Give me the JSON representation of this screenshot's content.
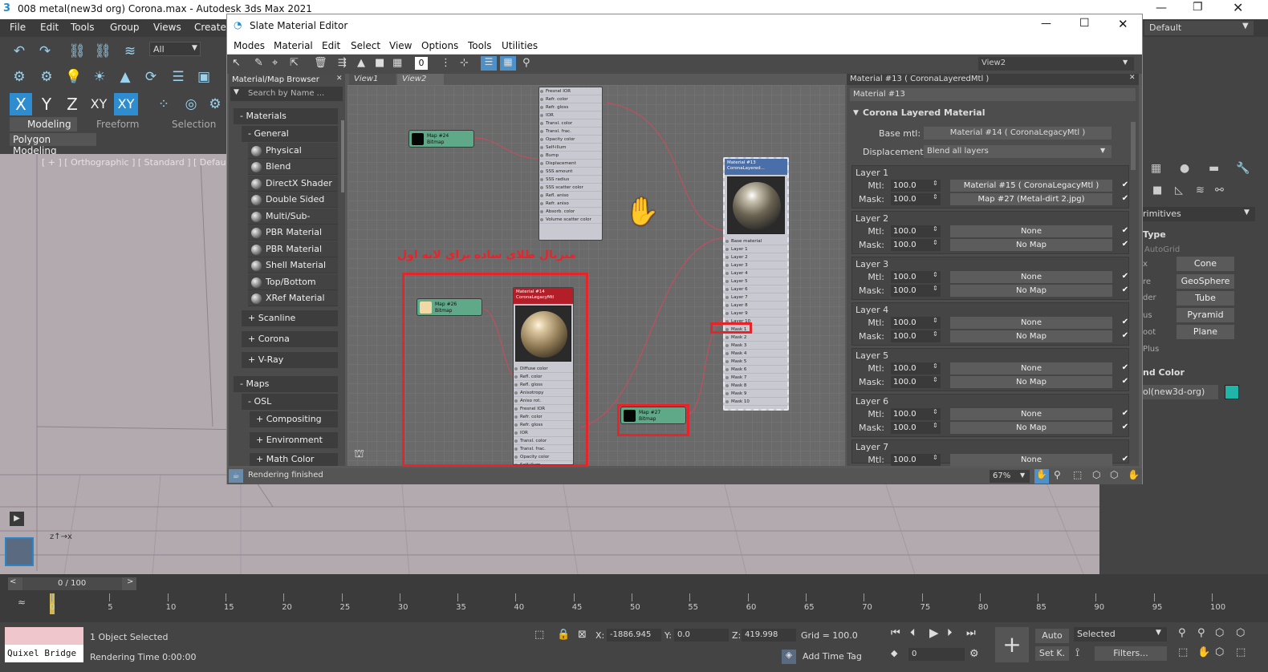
{
  "app": {
    "title": "008 metal(new3d org) Corona.max - Autodesk 3ds Max 2021",
    "workspace": "Default",
    "menu": [
      "File",
      "Edit",
      "Tools",
      "Group",
      "Views",
      "Create"
    ],
    "selection_filter": "All",
    "axes": [
      "X",
      "Y",
      "Z",
      "XY",
      "XY"
    ],
    "ribbon_tabs": [
      "Modeling",
      "Freeform",
      "Selection"
    ],
    "ribbon_sub": "Polygon Modeling",
    "viewport_label": "[ + ] [ Orthographic ] [ Standard ] [ Default Sha"
  },
  "slate": {
    "title": "Slate Material Editor",
    "menu": [
      "Modes",
      "Material",
      "Edit",
      "Select",
      "View",
      "Options",
      "Tools",
      "Utilities"
    ],
    "view_dropdown": "View2",
    "browser_title": "Material/Map Browser",
    "search_placeholder": "Search by Name ...",
    "cat_materials": "- Materials",
    "cat_general": "- General",
    "materials": [
      "Physical Material",
      "Blend",
      "DirectX Shader",
      "Double Sided",
      "Multi/Sub-Object",
      "PBR Material (M...",
      "PBR Material (S...",
      "Shell Material",
      "Top/Bottom",
      "XRef Material"
    ],
    "cat_scanline": "+ Scanline",
    "cat_corona": "+ Corona",
    "cat_vray": "+ V-Ray",
    "cat_maps": "- Maps",
    "cat_osl": "- OSL",
    "osl_items": [
      "+ Compositing",
      "+ Environment",
      "+ Math Color"
    ],
    "view_tabs": [
      "View1",
      "View2"
    ],
    "annotation": "متریال طلای ساده برای لایه اول",
    "status": "Rendering finished",
    "zoom": "67%"
  },
  "nodes": {
    "map24": {
      "name": "Map #24",
      "type": "Bitmap"
    },
    "map26": {
      "name": "Map #26",
      "type": "Bitmap"
    },
    "map27": {
      "name": "Map #27",
      "type": "Bitmap"
    },
    "legacy_title": "Material #14\nCoronaLegacyMtl",
    "legacy_slots": [
      "Diffuse color",
      "Refl. color",
      "Refl. gloss",
      "Anisotropy",
      "Aniso rot.",
      "Fresnel IOR",
      "Refr. color",
      "Refr. gloss",
      "IOR",
      "Transl. color",
      "Transl. frac.",
      "Opacity color",
      "Self-illum"
    ],
    "top_slots": [
      "Fresnel IOR",
      "Refr. color",
      "Refr. gloss",
      "IOR",
      "Transl. color",
      "Transl. frac.",
      "Opacity color",
      "Self-illum",
      "Bump",
      "Displacement",
      "SSS amount",
      "SSS radius",
      "SSS scatter color",
      "Refl. aniso",
      "Refr. aniso",
      "Absorb. color",
      "Volume scatter color"
    ],
    "layered_title": "Material #13\nCoronaLayered...",
    "layered_slots": [
      "Base material",
      "Layer 1",
      "Layer 2",
      "Layer 3",
      "Layer 4",
      "Layer 5",
      "Layer 6",
      "Layer 7",
      "Layer 8",
      "Layer 9",
      "Layer 10",
      "Mask 1",
      "Mask 2",
      "Mask 3",
      "Mask 4",
      "Mask 5",
      "Mask 6",
      "Mask 7",
      "Mask 8",
      "Mask 9",
      "Mask 10"
    ]
  },
  "props": {
    "header": "Material #13  ( CoronaLayeredMtl )",
    "name_field": "Material #13",
    "rollout": "Corona Layered Material",
    "base_label": "Base mtl:",
    "base_value": "Material #14  ( CoronaLegacyMtl )",
    "disp_label": "Displacement:",
    "disp_value": "Blend all layers",
    "mtl_label": "Mtl:",
    "mask_label": "Mask:",
    "layers": [
      {
        "name": "Layer 1",
        "mtl_amt": "100.0",
        "mtl": "Material #15  ( CoronaLegacyMtl )",
        "mask_amt": "100.0",
        "mask": "Map #27 (Metal-dirt 2.jpg)"
      },
      {
        "name": "Layer 2",
        "mtl_amt": "100.0",
        "mtl": "None",
        "mask_amt": "100.0",
        "mask": "No Map"
      },
      {
        "name": "Layer 3",
        "mtl_amt": "100.0",
        "mtl": "None",
        "mask_amt": "100.0",
        "mask": "No Map"
      },
      {
        "name": "Layer 4",
        "mtl_amt": "100.0",
        "mtl": "None",
        "mask_amt": "100.0",
        "mask": "No Map"
      },
      {
        "name": "Layer 5",
        "mtl_amt": "100.0",
        "mtl": "None",
        "mask_amt": "100.0",
        "mask": "No Map"
      },
      {
        "name": "Layer 6",
        "mtl_amt": "100.0",
        "mtl": "None",
        "mask_amt": "100.0",
        "mask": "No Map"
      },
      {
        "name": "Layer 7",
        "mtl_amt": "100.0",
        "mtl": "None"
      }
    ]
  },
  "rightpanel": {
    "dropdown": "rimitives",
    "type_title": "Type",
    "autogrid": "AutoGrid",
    "buttons": [
      "Cone",
      "GeoSphere",
      "Tube",
      "Pyramid",
      "Plane"
    ],
    "left_frags": [
      "x",
      "re",
      "der",
      "us",
      "oot",
      "Plus"
    ],
    "name_color_title": "nd Color",
    "object_name": "ol(new3d-org)",
    "swatch": "#1fb5a8"
  },
  "timeline": {
    "frame": "0 / 100",
    "ticks": [
      "0",
      "5",
      "10",
      "15",
      "20",
      "25",
      "30",
      "35",
      "40",
      "45",
      "50",
      "55",
      "60",
      "65",
      "70",
      "75",
      "80",
      "85",
      "90",
      "95",
      "100"
    ]
  },
  "bottom": {
    "quixel": "Quixel Bridge",
    "selected": "1 Object Selected",
    "render_time": "Rendering Time  0:00:00",
    "x_label": "X:",
    "x": "-1886.945",
    "y_label": "Y:",
    "y": "0.0",
    "z_label": "Z:",
    "z": "419.998",
    "grid": "Grid = 100.0",
    "add_time_tag": "Add Time Tag",
    "auto": "Auto",
    "setk": "Set K.",
    "selected_dd": "Selected",
    "filters": "Filters...",
    "frame_field": "0"
  }
}
